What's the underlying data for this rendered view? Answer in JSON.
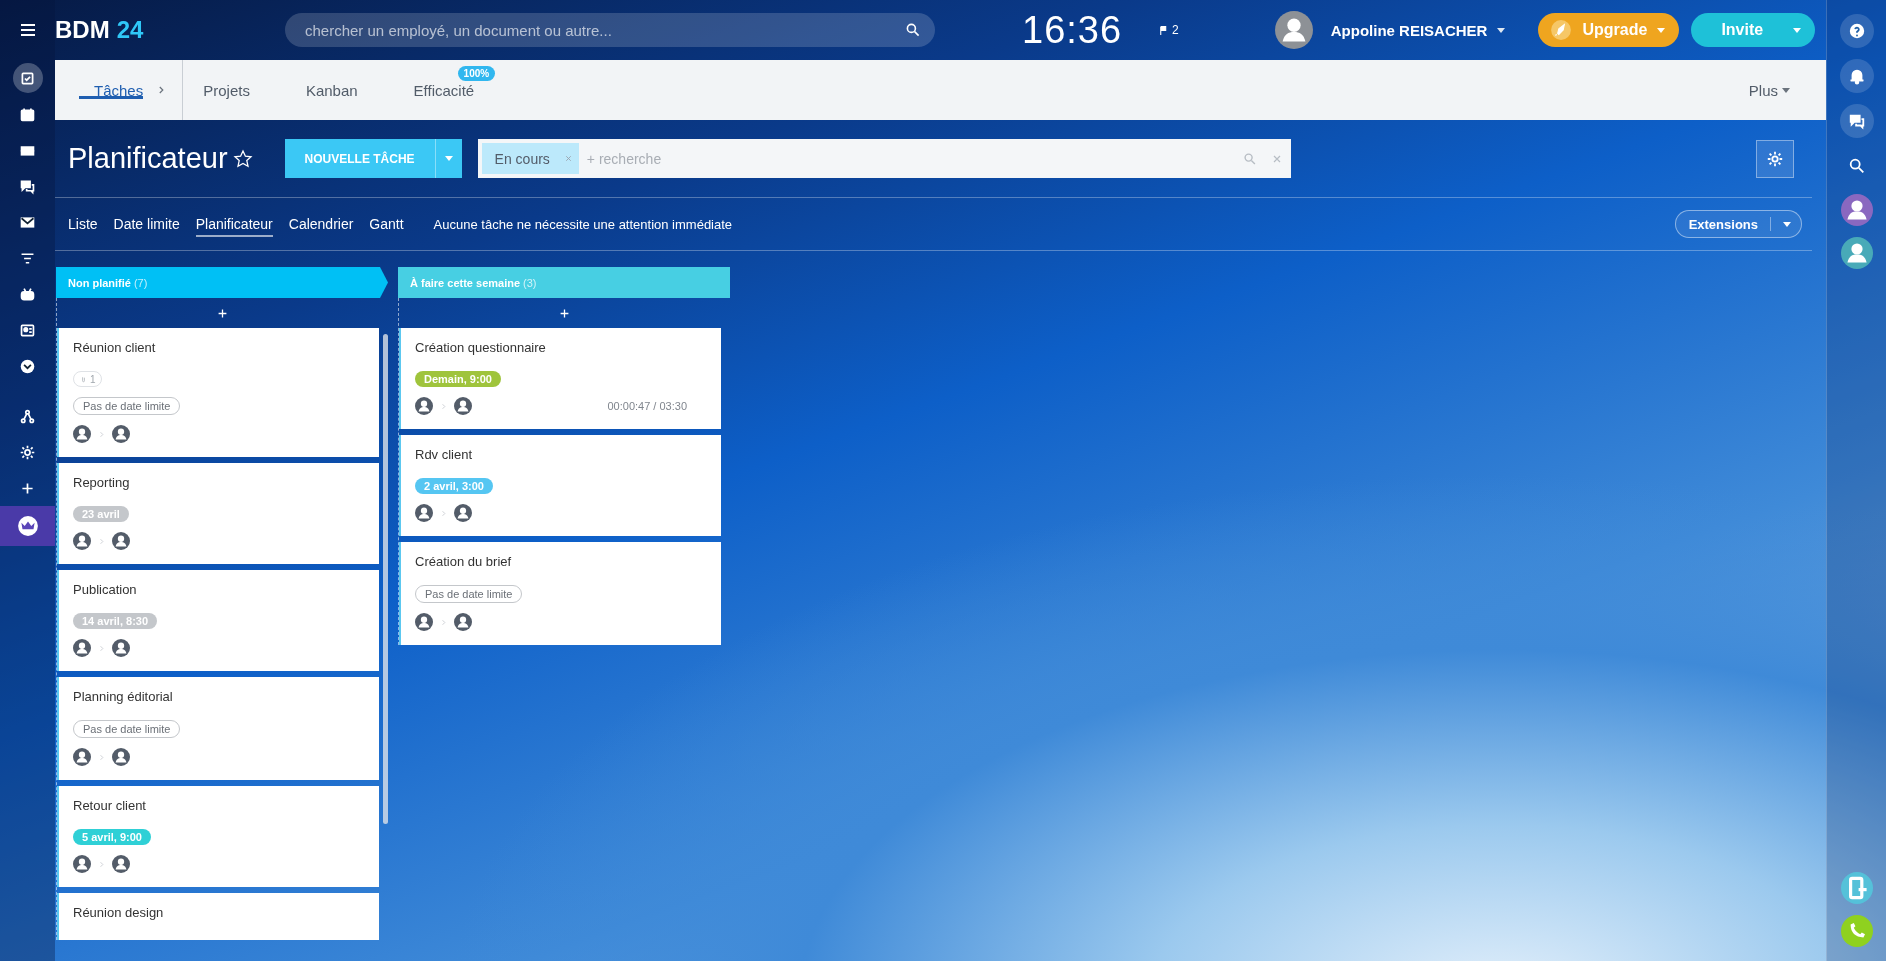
{
  "top_bar": {
    "logo": {
      "name": "BDM",
      "number": "24"
    },
    "search": {
      "placeholder": "chercher un employé, un document ou autre..."
    },
    "clock": "16:36",
    "flags": "2",
    "user": "Appoline REISACHER",
    "upgrade": "Upgrade",
    "invite": "Invite"
  },
  "left_sidebar": {
    "items": [
      {
        "kind": "tasks",
        "selected": true
      },
      {
        "kind": "calendar",
        "selected": false
      },
      {
        "kind": "drive",
        "selected": false
      },
      {
        "kind": "chat",
        "selected": false
      },
      {
        "kind": "mail",
        "selected": false
      },
      {
        "kind": "filter",
        "selected": false
      },
      {
        "kind": "robot",
        "selected": false
      },
      {
        "kind": "contact",
        "selected": false
      },
      {
        "kind": "chevron",
        "selected": false
      },
      {
        "kind": "network",
        "selected": false
      },
      {
        "kind": "gear",
        "selected": false
      },
      {
        "kind": "plus",
        "selected": false
      },
      {
        "kind": "crown",
        "selected": false
      }
    ]
  },
  "tabs": [
    {
      "label": "Tâches",
      "selected": true
    },
    {
      "label": "Projets",
      "selected": false
    },
    {
      "label": "Kanban",
      "selected": false
    },
    {
      "label": "Efficacité",
      "selected": false,
      "badge": "100%"
    }
  ],
  "more": "Plus",
  "toolbar": {
    "title": "Planificateur",
    "favorite": false,
    "new_task": "NOUVELLE TÂCHE",
    "filter_chip": "En cours",
    "placeholder": "+ recherche"
  },
  "view_tabs": [
    {
      "label": "Liste",
      "selected": false
    },
    {
      "label": "Date limite",
      "selected": false
    },
    {
      "label": "Planificateur",
      "selected": true
    },
    {
      "label": "Calendrier",
      "selected": false
    },
    {
      "label": "Gantt",
      "selected": false
    }
  ],
  "notice": "Aucune tâche ne nécessite une attention immédiate",
  "extensions": "Extensions",
  "columns": [
    {
      "title": "Non planifié",
      "count": "(7)",
      "color": "#00c0f5",
      "cards": [
        {
          "title": "Réunion client",
          "attachments": "1",
          "deadline": {
            "text": "Pas de date limite"
          }
        },
        {
          "title": "Reporting",
          "deadline": {
            "text": "23 avril",
            "color": "#c4c7cb"
          }
        },
        {
          "title": "Publication",
          "deadline": {
            "text": "14 avril, 8:30",
            "color": "#c4c7cb"
          }
        },
        {
          "title": "Planning éditorial",
          "deadline": {
            "text": "Pas de date limite"
          }
        },
        {
          "title": "Retour client",
          "deadline": {
            "text": "5 avril, 9:00",
            "color": "#2fd0d6"
          }
        },
        {
          "title": "Réunion design"
        }
      ]
    },
    {
      "title": "À faire cette semaine",
      "count": "(3)",
      "color": "#47cfe3",
      "cards": [
        {
          "title": "Création questionnaire",
          "deadline": {
            "text": "Demain, 9:00",
            "color": "#9fc43c"
          },
          "timer": "00:00:47 / 03:30"
        },
        {
          "title": "Rdv client",
          "deadline": {
            "text": "2 avril, 3:00",
            "color": "#55c6f2"
          }
        },
        {
          "title": "Création du brief",
          "deadline": {
            "text": "Pas de date limite"
          }
        }
      ]
    }
  ],
  "right_sidebar": {
    "items": [
      {
        "kind": "help"
      },
      {
        "kind": "bell"
      },
      {
        "kind": "chat"
      },
      {
        "kind": "search"
      },
      {
        "kind": "avatar",
        "color": "#8a68c0"
      },
      {
        "kind": "avatar",
        "color": "#48aab8"
      }
    ],
    "bottom": [
      {
        "kind": "device"
      },
      {
        "kind": "call"
      }
    ]
  }
}
